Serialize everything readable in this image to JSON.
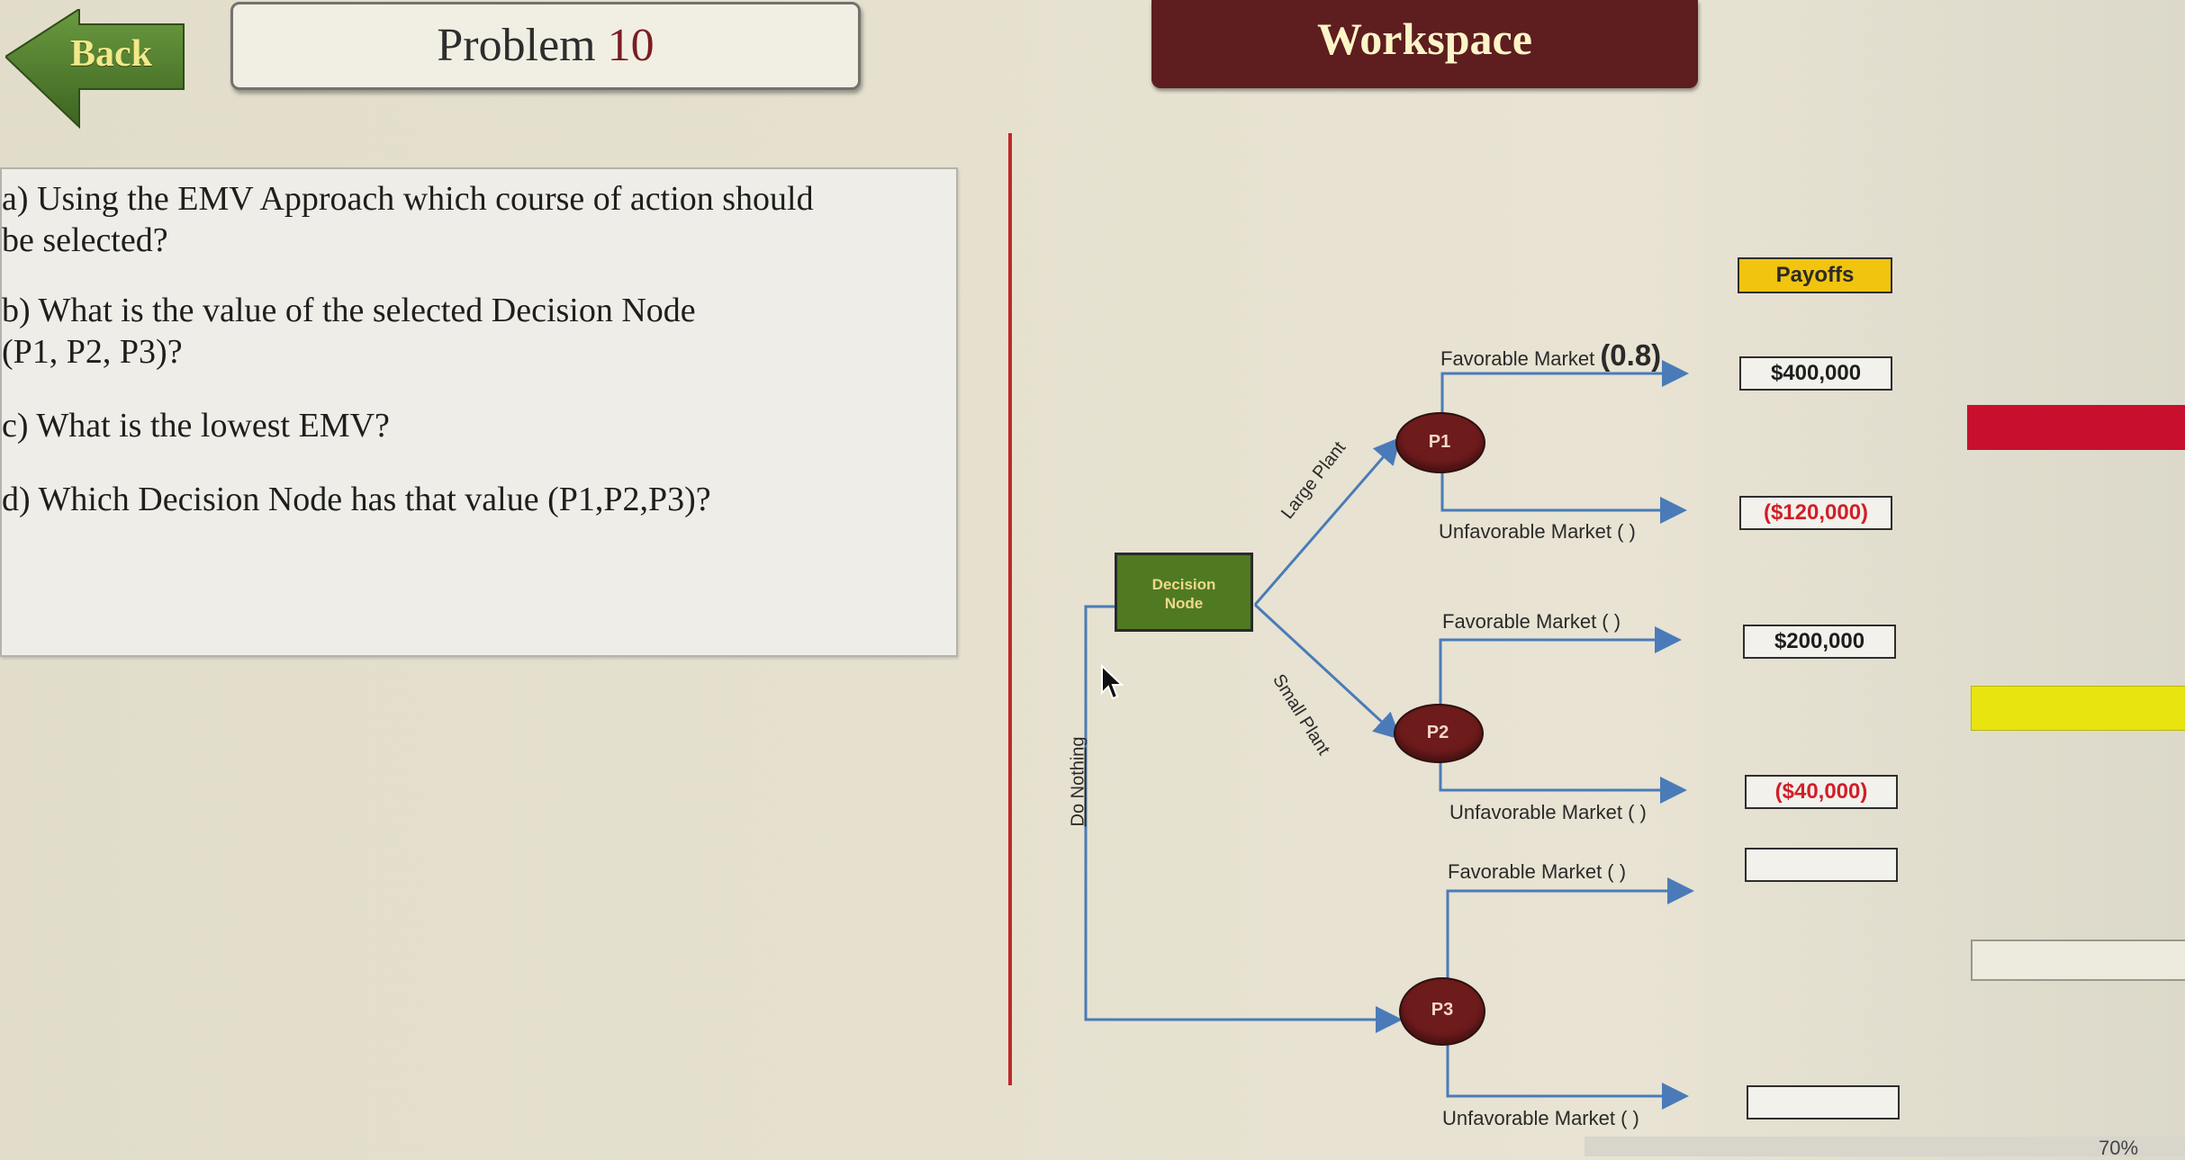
{
  "header": {
    "back_label": "Back",
    "problem_title": "Problem",
    "problem_number": "10",
    "workspace_label": "Workspace"
  },
  "questions": [
    "a) Using the EMV Approach which course of action should",
    "be selected?",
    "b) What is the value of the selected Decision Node",
    "(P1, P2, P3)?",
    "c) What is the lowest EMV?",
    "d) Which Decision Node has that value (P1,P2,P3)?"
  ],
  "diagram": {
    "decision_node": [
      "Decision",
      "Node"
    ],
    "branches": {
      "large": "Large Plant",
      "small": "Small Plant",
      "nothing": "Do Nothing"
    },
    "chance_nodes": [
      "P1",
      "P2",
      "P3"
    ],
    "outcomes": {
      "p1_fav": "Favorable Market",
      "p1_fav_prob": "(0.8)",
      "p1_unfav": "Unfavorable  Market ( )",
      "p2_fav": "Favorable Market ( )",
      "p2_unfav": "Unfavorable Market ( )",
      "p3_fav": "Favorable Market ( )",
      "p3_unfav": "Unfavorable Market ( )"
    }
  },
  "payoffs": {
    "header": "Payoffs",
    "values": [
      "$400,000",
      "($120,000)",
      "$200,000",
      "($40,000)",
      "",
      ""
    ]
  },
  "status_bar": {
    "zoom": "70%"
  },
  "colors": {
    "back_green": "#4a7a2d",
    "workspace_bg": "#5e1d1f",
    "node_fill": "#6e1b1c",
    "decision_fill": "#4f7a22",
    "line_blue": "#4a7bb8",
    "swatch_red": "#c8102e",
    "swatch_yellow": "#e8e410",
    "swatch_light": "#ecebdd"
  }
}
